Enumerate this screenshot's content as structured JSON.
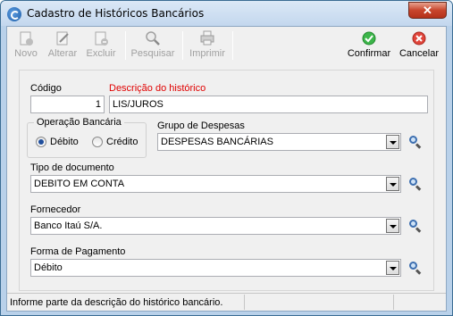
{
  "window": {
    "title": "Cadastro de Históricos Bancários",
    "close_label": "✕"
  },
  "toolbar": {
    "novo": "Novo",
    "alterar": "Alterar",
    "excluir": "Excluir",
    "pesquisar": "Pesquisar",
    "imprimir": "Imprimir",
    "confirmar": "Confirmar",
    "cancelar": "Cancelar"
  },
  "form": {
    "codigo_label": "Código",
    "codigo_value": "1",
    "descricao_label": "Descrição do histórico",
    "descricao_value": "LIS/JUROS",
    "operacao_label": "Operação Bancária",
    "debito_label": "Débito",
    "credito_label": "Crédito",
    "grupo_label": "Grupo de Despesas",
    "grupo_value": "DESPESAS BANCÁRIAS",
    "tipo_label": "Tipo de documento",
    "tipo_value": "DEBITO EM CONTA",
    "fornecedor_label": "Fornecedor",
    "fornecedor_value": "Banco Itaú S/A.",
    "forma_label": "Forma de Pagamento",
    "forma_value": "Débito"
  },
  "status": {
    "text": "Informe parte da descrição do histórico bancário."
  },
  "colors": {
    "required_label": "#e00000",
    "confirm_icon": "#2fa82f",
    "cancel_icon": "#d8322a"
  }
}
